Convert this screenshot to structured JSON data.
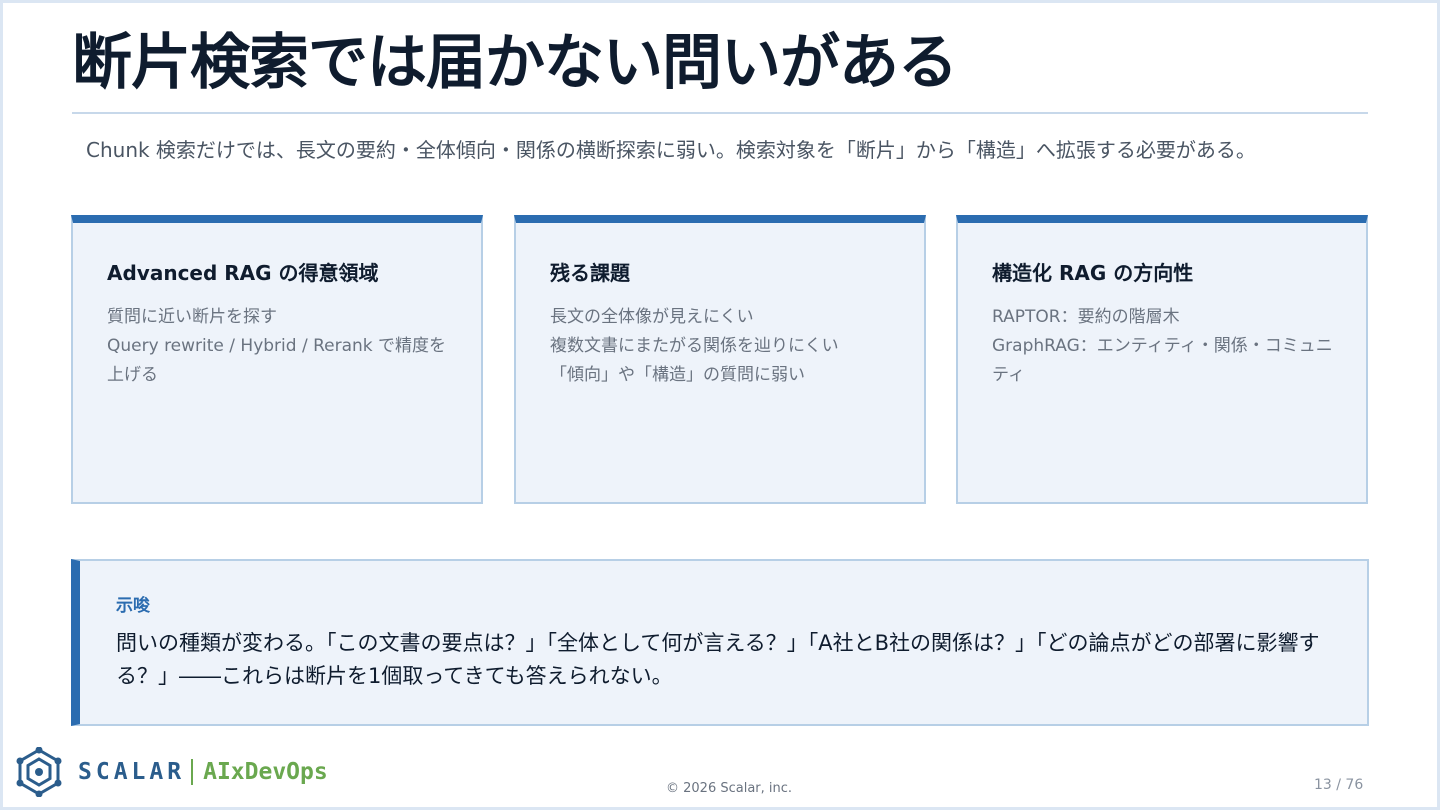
{
  "slide": {
    "title": "断片検索では届かない問いがある",
    "lead": "Chunk 検索だけでは、長文の要約・全体傾向・関係の横断探索に弱い。検索対象を「断片」から「構造」へ拡張する必要がある。"
  },
  "cards": [
    {
      "title": "Advanced RAG の得意領域",
      "lines": [
        "質問に近い断片を探す",
        "Query rewrite / Hybrid / Rerank で精度を上げる"
      ]
    },
    {
      "title": "残る課題",
      "lines": [
        "長文の全体像が見えにくい",
        "複数文書にまたがる関係を辿りにくい",
        "「傾向」や「構造」の質問に弱い"
      ]
    },
    {
      "title": "構造化 RAG の方向性",
      "lines": [
        "RAPTOR：要約の階層木",
        "GraphRAG：エンティティ・関係・コミュニティ"
      ]
    }
  ],
  "callout": {
    "label": "示唆",
    "text": "問いの種類が変わる。「この文書の要点は？」「全体として何が言える？」「A社とB社の関係は？」「どの論点がどの部署に影響する？」――これらは断片を1個取ってきても答えられない。"
  },
  "footer": {
    "brand": "SCALAR",
    "brand_sub": "AIxDevOps",
    "copyright": "© 2026 Scalar, inc.",
    "page": "13 / 76"
  },
  "colors": {
    "accent": "#2b6cb0",
    "card_bg": "#eef3fa",
    "card_border": "#b7cfe6",
    "brand_green": "#6aa84f",
    "brand_blue": "#2b5d8c"
  },
  "icons": {
    "logo": "scalar-logo-icon"
  }
}
